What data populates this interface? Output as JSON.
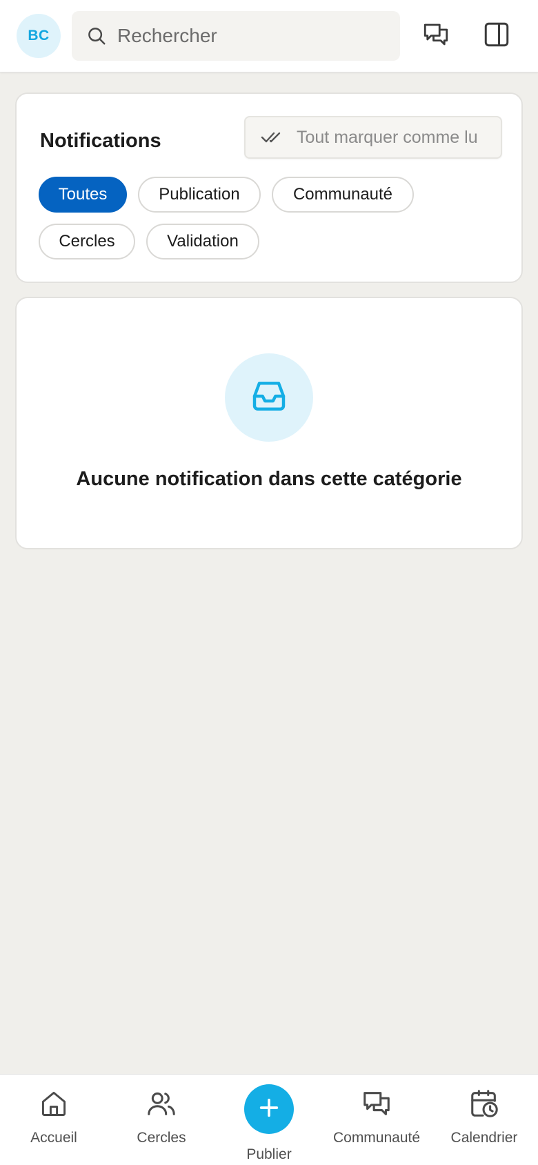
{
  "header": {
    "avatar_initials": "BC",
    "search": {
      "placeholder": "Rechercher",
      "value": "",
      "icon": "search-icon"
    },
    "messages_icon": "messages-icon",
    "panel_icon": "sidebar-panel-icon"
  },
  "notifications": {
    "title": "Notifications",
    "mark_all_read_label": "Tout marquer comme lu",
    "mark_all_read_icon": "double-check-icon",
    "filters": [
      {
        "label": "Toutes",
        "active": true
      },
      {
        "label": "Publication",
        "active": false
      },
      {
        "label": "Communauté",
        "active": false
      },
      {
        "label": "Cercles",
        "active": false
      },
      {
        "label": "Validation",
        "active": false
      }
    ]
  },
  "empty_state": {
    "icon": "inbox-icon",
    "message": "Aucune notification dans cette catégorie"
  },
  "bottom_nav": {
    "items": [
      {
        "label": "Accueil",
        "icon": "home-icon"
      },
      {
        "label": "Cercles",
        "icon": "users-icon"
      },
      {
        "label": "Publier",
        "icon": "plus-icon"
      },
      {
        "label": "Communauté",
        "icon": "messages-icon"
      },
      {
        "label": "Calendrier",
        "icon": "calendar-clock-icon"
      }
    ]
  },
  "colors": {
    "accent": "#0563c1",
    "brand_light_blue": "#14aee5",
    "avatar_bg": "#dff3fb",
    "page_bg": "#f0efeb"
  }
}
